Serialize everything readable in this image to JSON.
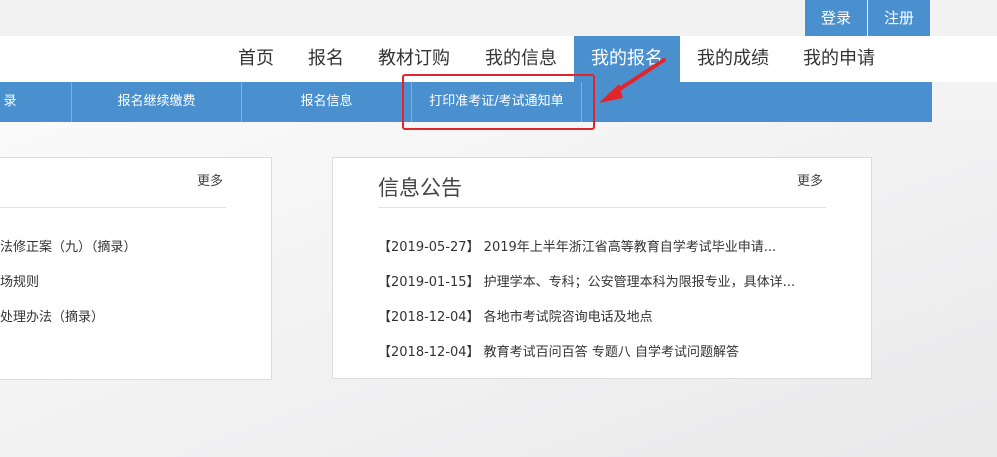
{
  "auth": {
    "login_label": "登录",
    "register_label": "注册"
  },
  "nav": {
    "items": [
      {
        "label": "首页"
      },
      {
        "label": "报名"
      },
      {
        "label": "教材订购"
      },
      {
        "label": "我的信息"
      },
      {
        "label": "我的报名"
      },
      {
        "label": "我的成绩"
      },
      {
        "label": "我的申请"
      }
    ],
    "active_label": "我的报名"
  },
  "subnav": {
    "items": [
      {
        "label": "录"
      },
      {
        "label": "报名继续缴费"
      },
      {
        "label": "报名信息"
      },
      {
        "label": "打印准考证/考试通知单"
      }
    ]
  },
  "left_panel": {
    "more_label": "更多",
    "items": [
      {
        "text": "法修正案（九）（摘录）"
      },
      {
        "text": "场规则"
      },
      {
        "text": "处理办法（摘录）"
      }
    ]
  },
  "right_panel": {
    "title": "信息公告",
    "more_label": "更多",
    "items": [
      {
        "text": "【2019-05-27】 2019年上半年浙江省高等教育自学考试毕业申请..."
      },
      {
        "text": "【2019-01-15】 护理学本、专科；公安管理本科为限报专业，具体详..."
      },
      {
        "text": "【2018-12-04】 各地市考试院咨询电话及地点"
      },
      {
        "text": "【2018-12-04】 教育考试百问百答 专题八 自学考试问题解答"
      }
    ]
  },
  "colors": {
    "primary": "#4a90cf",
    "annotation": "#e1262b"
  }
}
